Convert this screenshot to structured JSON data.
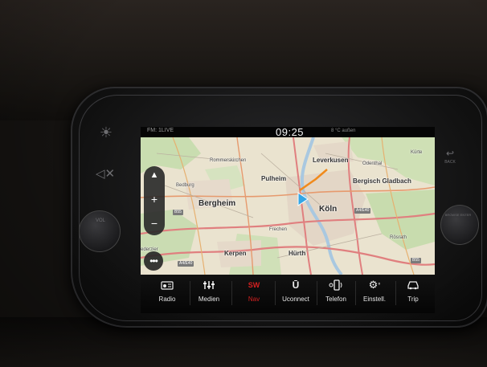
{
  "status": {
    "radio": "FM: 1LIVE",
    "time": "09:25",
    "temperature": "8 °C außen"
  },
  "map": {
    "places": [
      {
        "name": "Leverkusen",
        "size": "m"
      },
      {
        "name": "Odenthal",
        "size": "s"
      },
      {
        "name": "Kürte",
        "size": "s"
      },
      {
        "name": "Rommerskirchen",
        "size": "s"
      },
      {
        "name": "Pulheim",
        "size": "m"
      },
      {
        "name": "Bergisch Gladbach",
        "size": "m"
      },
      {
        "name": "Bedburg",
        "size": "s"
      },
      {
        "name": "Bergheim",
        "size": "l"
      },
      {
        "name": "Köln",
        "size": "l"
      },
      {
        "name": "Frechen",
        "size": "s"
      },
      {
        "name": "Rösrath",
        "size": "s"
      },
      {
        "name": "Kerpen",
        "size": "m"
      },
      {
        "name": "Hürth",
        "size": "m"
      },
      {
        "name": "ederzier",
        "size": "s"
      }
    ],
    "road_labels": [
      "B55",
      "A4/E40",
      "A4/E40",
      "B55"
    ],
    "zoom_controls": {
      "up": "▲",
      "plus": "+",
      "minus": "−"
    },
    "more": "•••"
  },
  "tabs": [
    {
      "label": "Radio",
      "icon": "radio-icon"
    },
    {
      "label": "Medien",
      "icon": "media-icon"
    },
    {
      "label": "Nav",
      "icon": "nav-compass-icon",
      "glyph": "SW",
      "active": true
    },
    {
      "label": "Uconnect",
      "icon": "uconnect-icon",
      "glyph": "Ū"
    },
    {
      "label": "Telefon",
      "icon": "phone-icon"
    },
    {
      "label": "Einstell.",
      "icon": "settings-icon"
    },
    {
      "label": "Trip",
      "icon": "car-icon"
    }
  ],
  "side_labels": {
    "vol": "VOL",
    "back": "BACK",
    "browse": "BROWSE ENTER"
  },
  "colors": {
    "active_tab": "#d42020",
    "vehicle_marker": "#33a6e6",
    "route": "#f08a1c"
  }
}
